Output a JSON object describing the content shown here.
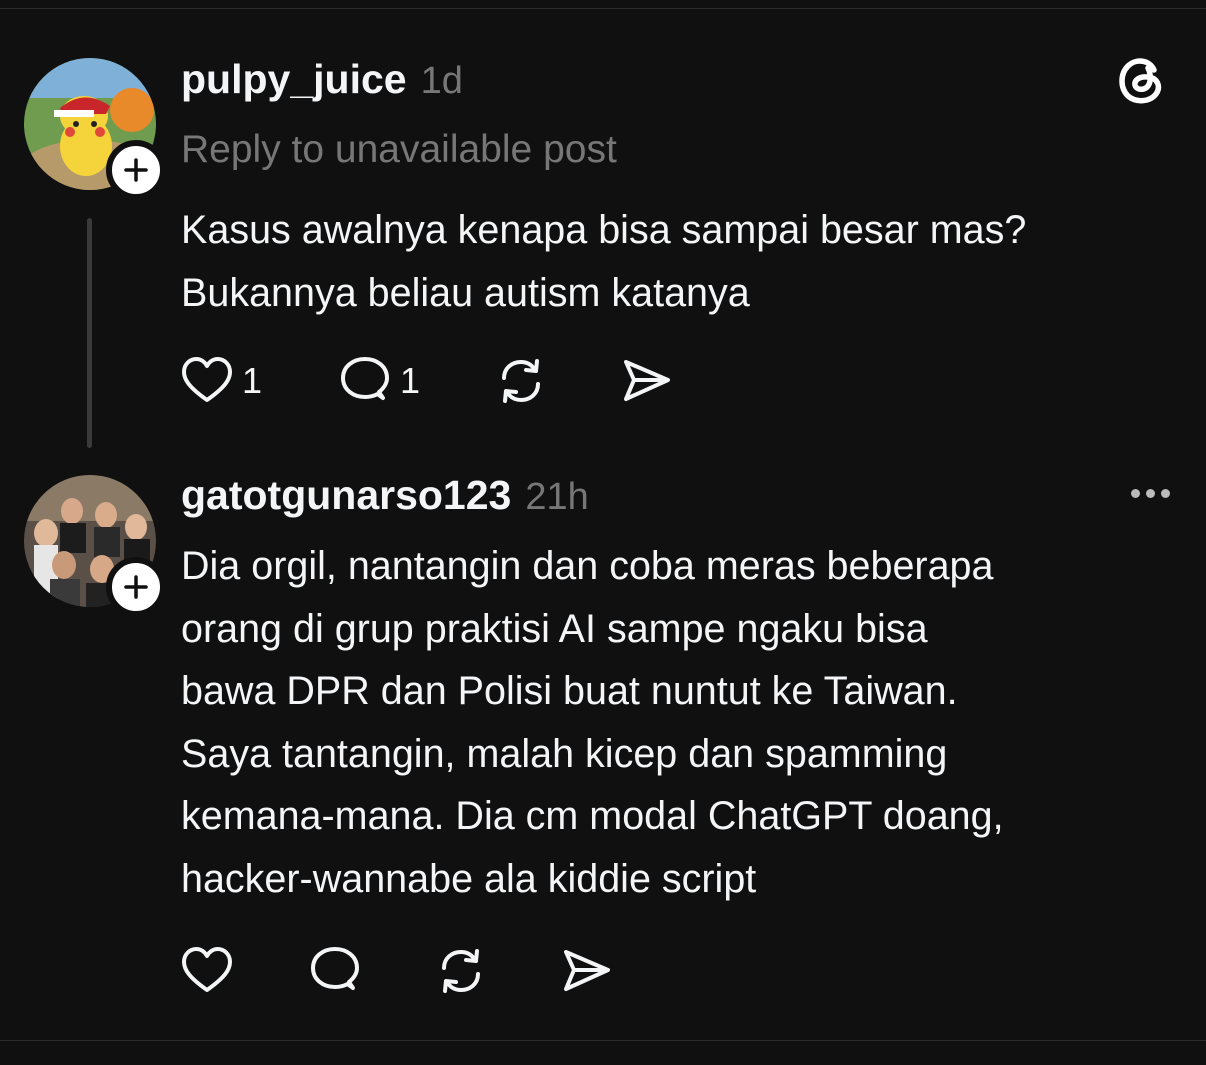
{
  "posts": [
    {
      "username": "pulpy_juice",
      "time": "1d",
      "reply_context": "Reply to unavailable post",
      "text_lines": [
        "Kasus awalnya kenapa bisa sampai besar mas?",
        "Bukannya beliau autism katanya"
      ],
      "likes": "1",
      "replies": "1"
    },
    {
      "username": "gatotgunarso123",
      "time": "21h",
      "text_lines": [
        "Dia orgil, nantangin dan coba meras beberapa",
        "orang di grup praktisi AI sampe ngaku bisa",
        "bawa DPR dan Polisi buat nuntut ke Taiwan.",
        "Saya tantangin, malah kicep dan spamming",
        "kemana-mana. Dia cm modal ChatGPT doang,",
        "hacker-wannabe ala kiddie script"
      ]
    }
  ],
  "icons": {
    "brand": "threads-logo-icon",
    "like": "heart-icon",
    "reply": "comment-icon",
    "repost": "repost-icon",
    "share": "send-icon",
    "follow": "plus-icon",
    "more": "more-dots-icon"
  },
  "colors": {
    "background": "#101010",
    "text": "#f3f5f7",
    "muted": "#777777",
    "thread_line": "#3a3a3a"
  }
}
